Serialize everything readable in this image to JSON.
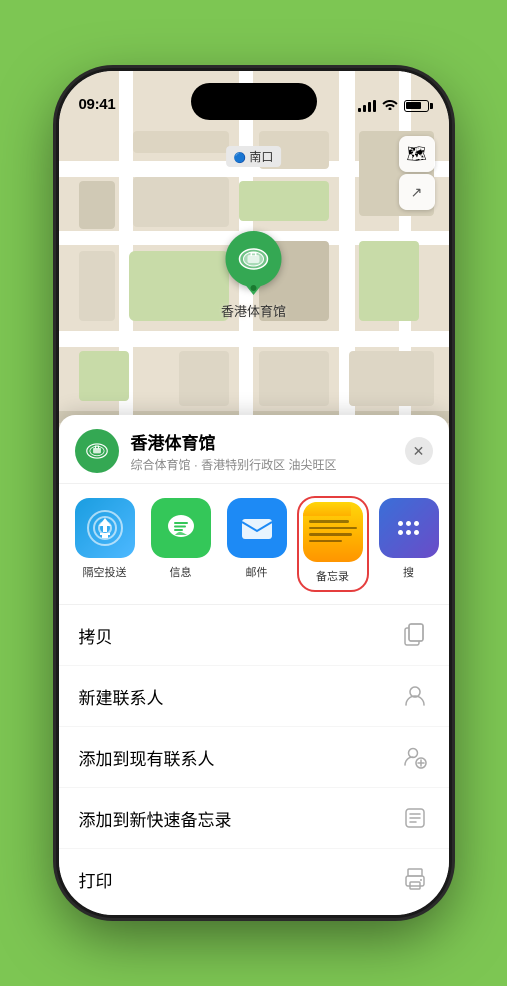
{
  "status": {
    "time": "09:41",
    "time_with_arrow": "09:41 ▶"
  },
  "map": {
    "nav_label": "南口",
    "venue_label": "香港体育馆"
  },
  "map_controls": {
    "layers_icon": "🗺",
    "location_icon": "↗"
  },
  "sheet": {
    "venue_name": "香港体育馆",
    "venue_desc": "综合体育馆 · 香港特别行政区 油尖旺区",
    "close_label": "✕"
  },
  "share_apps": [
    {
      "id": "airdrop",
      "label": "隔空投送"
    },
    {
      "id": "messages",
      "label": "信息"
    },
    {
      "id": "mail",
      "label": "邮件"
    },
    {
      "id": "notes",
      "label": "备忘录"
    },
    {
      "id": "more",
      "label": "搜"
    }
  ],
  "actions": [
    {
      "id": "copy",
      "label": "拷贝",
      "icon": "copy"
    },
    {
      "id": "new-contact",
      "label": "新建联系人",
      "icon": "person"
    },
    {
      "id": "add-contact",
      "label": "添加到现有联系人",
      "icon": "person-add"
    },
    {
      "id": "quick-note",
      "label": "添加到新快速备忘录",
      "icon": "note"
    },
    {
      "id": "print",
      "label": "打印",
      "icon": "print"
    }
  ]
}
